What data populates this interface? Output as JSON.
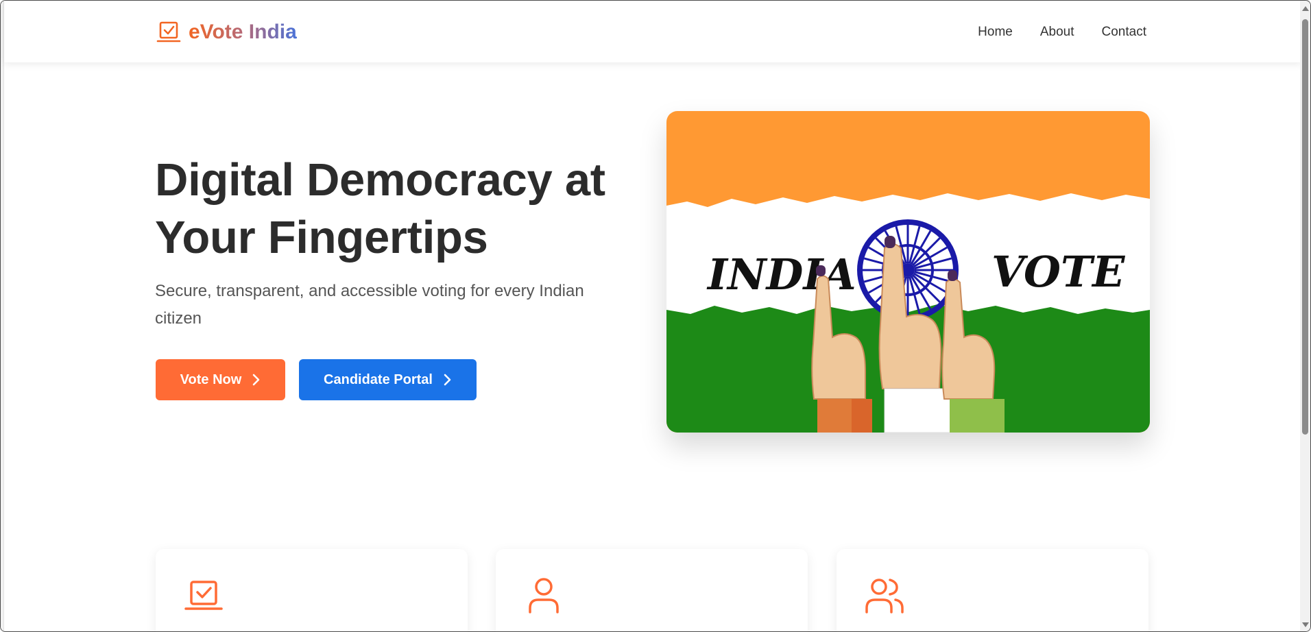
{
  "brand": {
    "name": "eVote India",
    "icon": "vote-laptop-icon"
  },
  "nav": {
    "items": [
      "Home",
      "About",
      "Contact"
    ]
  },
  "hero": {
    "title": "Digital Democracy at Your Fingertips",
    "subtitle": "Secure, transparent, and accessible voting for every Indian citizen",
    "buttons": {
      "vote_now": "Vote Now",
      "candidate_portal": "Candidate Portal"
    },
    "image": {
      "word_left": "INDIA",
      "word_right": "VOTE",
      "depicts": [
        "indian-flag",
        "ashoka-chakra",
        "inked-fingers"
      ]
    }
  },
  "features": [
    {
      "icon": "vote-laptop-icon"
    },
    {
      "icon": "user-icon"
    },
    {
      "icon": "users-icon"
    }
  ],
  "colors": {
    "primary_orange": "#ff6b35",
    "primary_blue": "#1a73e8",
    "saffron": "#ff9933",
    "india_green": "#138808",
    "chakra_navy": "#000080",
    "heading": "#2c2c2c"
  }
}
